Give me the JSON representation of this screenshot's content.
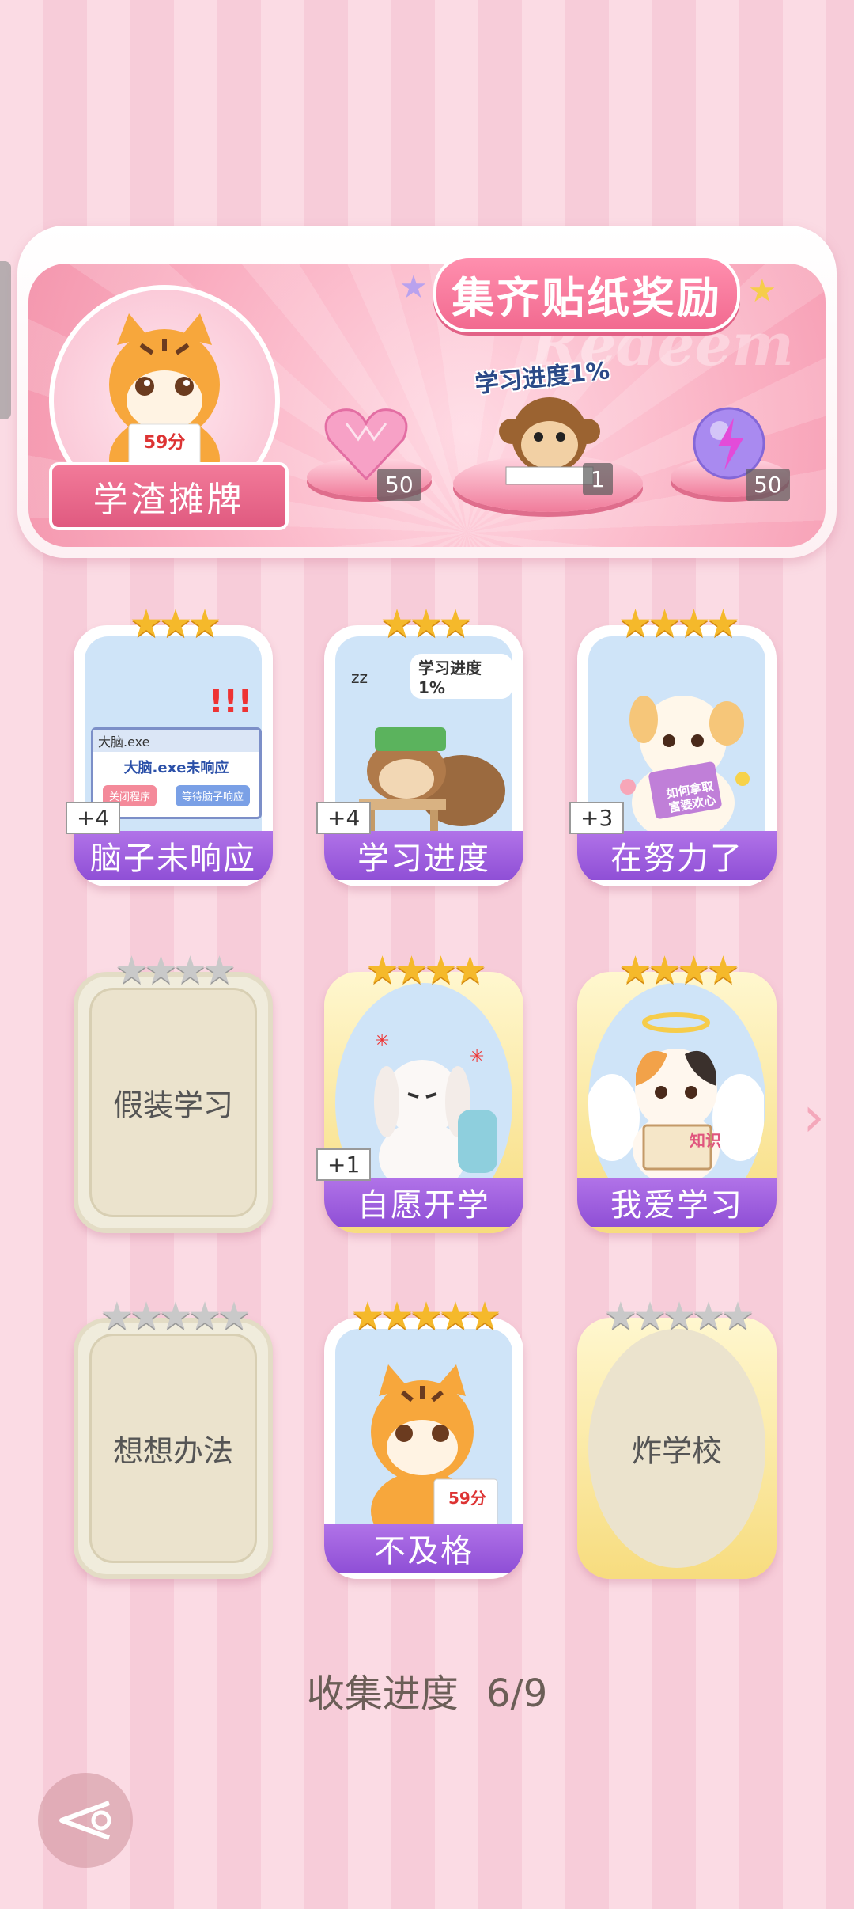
{
  "banner": {
    "title": "集齐贴纸奖励",
    "watermark": "Redeem",
    "ribbon_label": "学渣摊牌",
    "tiger_note": "59分",
    "progress_label": "学习进度1%",
    "rewards": [
      {
        "name": "heart-gem",
        "count": "50"
      },
      {
        "name": "monkey-sticker",
        "count": "1"
      },
      {
        "name": "lightning-orb",
        "count": "50"
      }
    ]
  },
  "cards": [
    {
      "label": "脑子未响应",
      "stars": 3,
      "max": 3,
      "plus": "+4",
      "state": "unlocked",
      "popup_title": "大脑.exe",
      "popup_msg": "大脑.exe未响应",
      "btn1": "关闭程序",
      "btn2": "等待脑子响应"
    },
    {
      "label": "学习进度",
      "stars": 3,
      "max": 3,
      "plus": "+4",
      "state": "unlocked",
      "art_text": "学习进度1%"
    },
    {
      "label": "在努力了",
      "stars": 4,
      "max": 4,
      "plus": "+3",
      "state": "unlocked",
      "art_text": "如何拿取富婆欢心"
    },
    {
      "label": "假装学习",
      "stars": 0,
      "max": 4,
      "plus": "",
      "state": "locked"
    },
    {
      "label": "自愿开学",
      "stars": 4,
      "max": 4,
      "plus": "+1",
      "state": "gold"
    },
    {
      "label": "我爱学习",
      "stars": 4,
      "max": 4,
      "plus": "",
      "state": "gold",
      "art_text": "知识"
    },
    {
      "label": "想想办法",
      "stars": 0,
      "max": 5,
      "plus": "",
      "state": "locked"
    },
    {
      "label": "不及格",
      "stars": 5,
      "max": 5,
      "plus": "",
      "state": "unlocked",
      "art_text": "59分"
    },
    {
      "label": "炸学校",
      "stars": 0,
      "max": 5,
      "plus": "",
      "state": "locked-gold"
    }
  ],
  "progress": {
    "label": "收集进度",
    "value": "6/9"
  }
}
